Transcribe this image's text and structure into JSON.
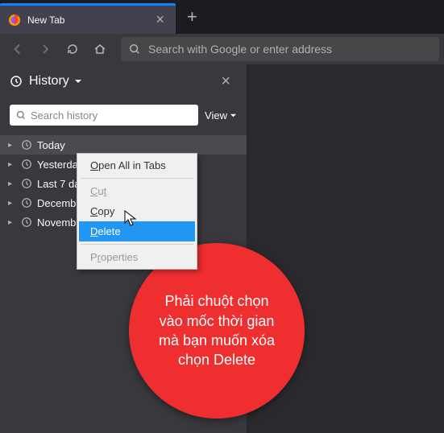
{
  "tab": {
    "title": "New Tab"
  },
  "address": {
    "placeholder": "Search with Google or enter address"
  },
  "sidebar": {
    "title": "History",
    "search_placeholder": "Search history",
    "view_label": "View"
  },
  "history_items": [
    {
      "label": "Today"
    },
    {
      "label": "Yesterday"
    },
    {
      "label": "Last 7 days"
    },
    {
      "label": "December"
    },
    {
      "label": "November"
    }
  ],
  "context_menu": {
    "open_all": "Open All in Tabs",
    "cut": "Cut",
    "copy": "Copy",
    "delete": "Delete",
    "properties": "Properties"
  },
  "callout": {
    "text": "Phải chuột chọn vào mốc thời gian mà bạn muốn xóa chọn Delete"
  }
}
